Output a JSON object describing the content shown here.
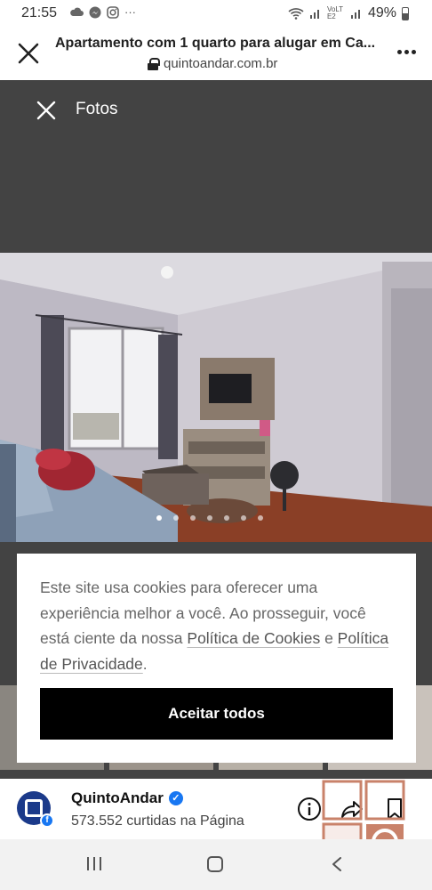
{
  "status_bar": {
    "time": "21:55",
    "dots": "···",
    "signal_text": "VoLTE2",
    "battery": "49%"
  },
  "browser": {
    "title": "Apartamento com 1 quarto para alugar em Ca...",
    "url": "quintoandar.com.br"
  },
  "viewer": {
    "title": "Fotos",
    "photo_dots_total": 7,
    "photo_dots_active": 0
  },
  "cookie": {
    "text_prefix": "Este site usa cookies para oferecer uma experiência melhor a você. Ao prosseguir, você está ciente da nossa ",
    "cookies_link": "Política de Cookies",
    "and": " e ",
    "privacy_link": "Política de Privacidade",
    "period": ".",
    "accept_button": "Aceitar todos"
  },
  "page_bar": {
    "name": "QuintoAndar",
    "likes": "573.552 curtidas na Página"
  },
  "colors": {
    "viewer_bg": "#434343",
    "facebook_blue": "#1877f2",
    "brand_navy": "#1b3a8a",
    "watermark": "#c9826a"
  }
}
